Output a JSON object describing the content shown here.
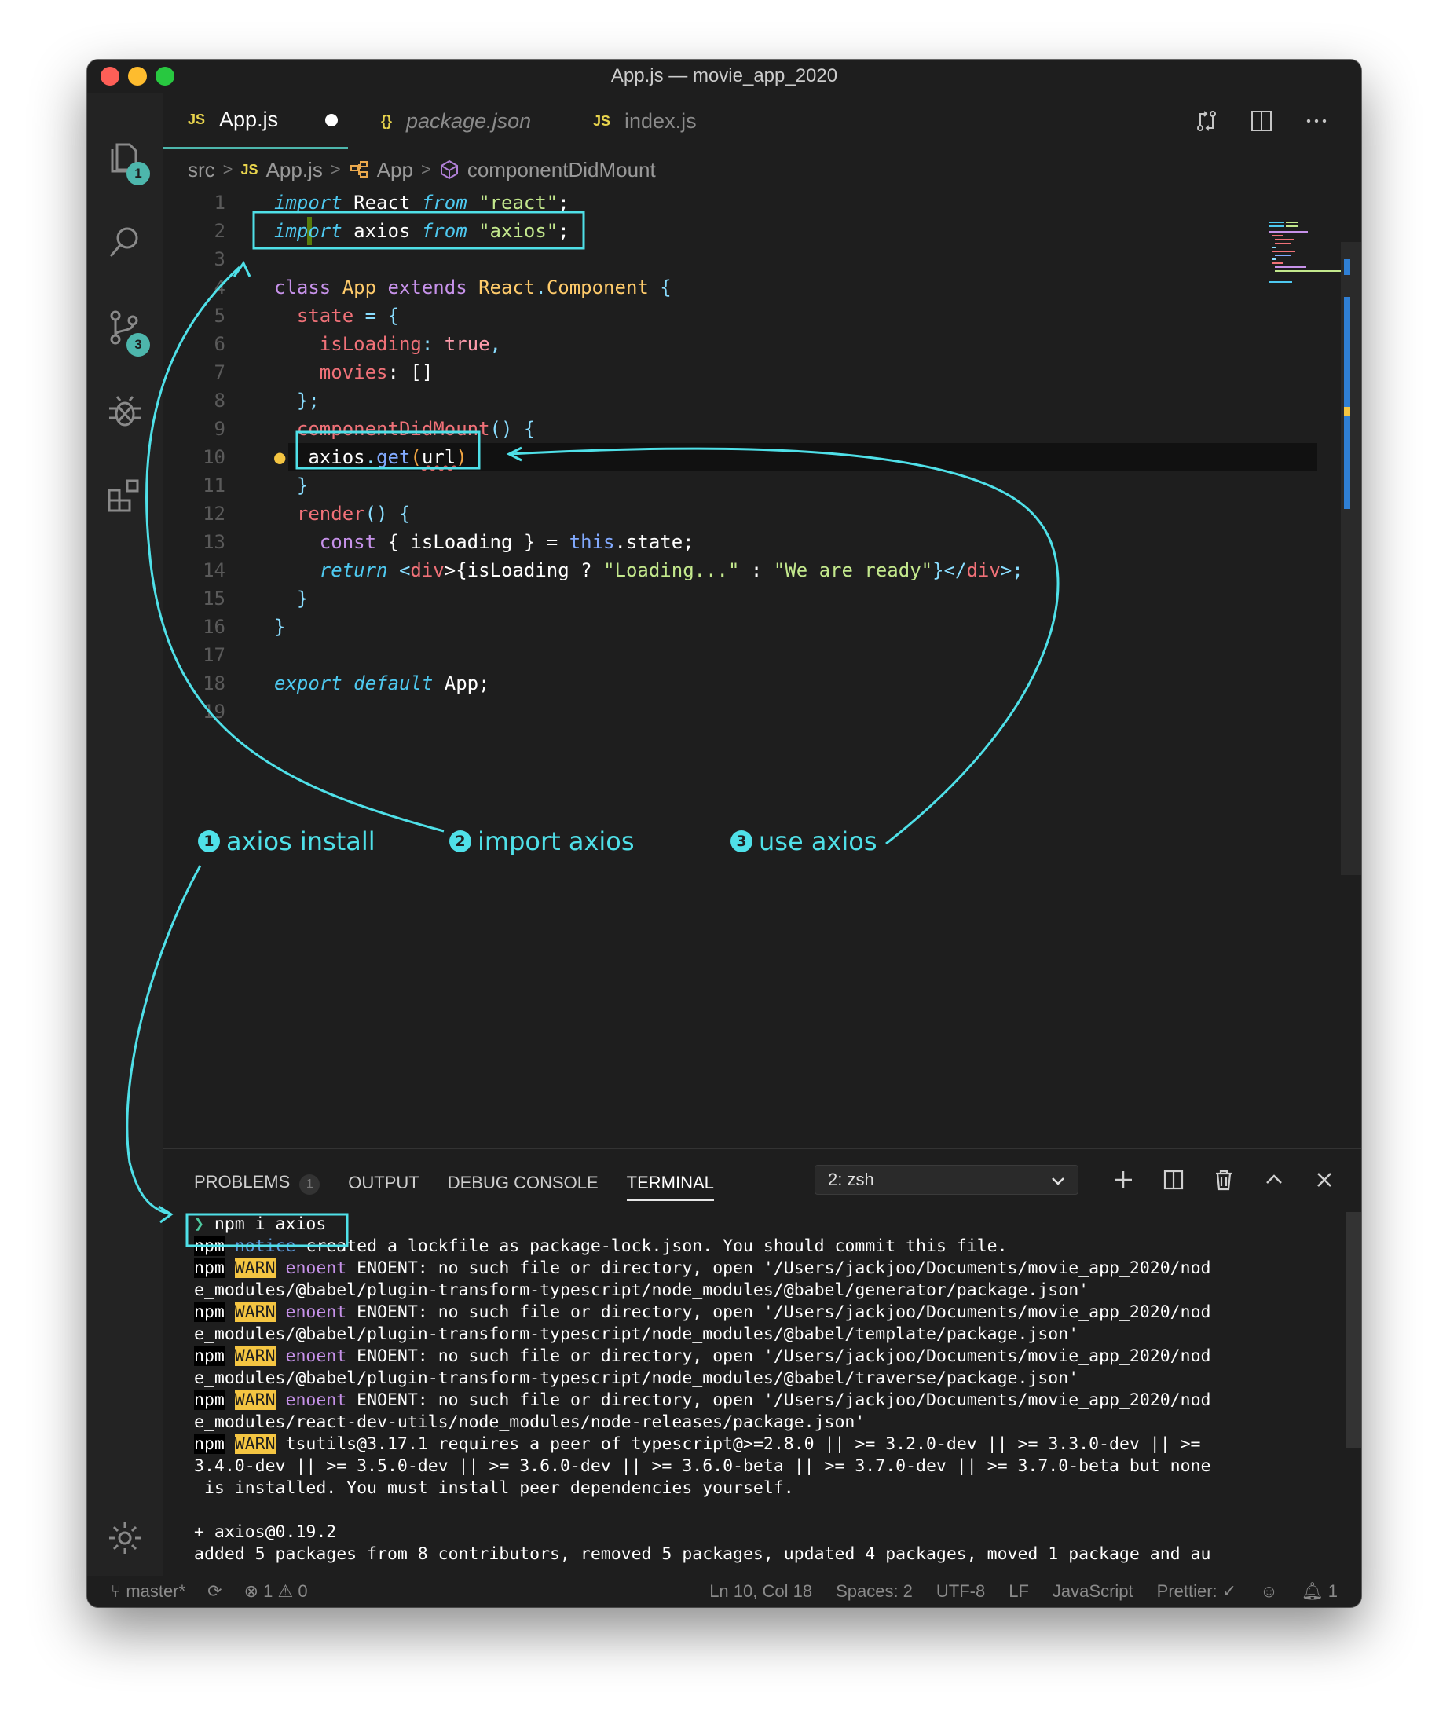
{
  "window": {
    "title": "App.js — movie_app_2020"
  },
  "colors": {
    "accent": "#4db6ac",
    "annotation": "#4fe0e8",
    "warn": "#f4c542",
    "editor_bg": "#1e1e1e"
  },
  "activity": {
    "explorer_badge": "1",
    "scm_badge": "3",
    "icons": [
      "files-icon",
      "search-icon",
      "source-control-icon",
      "debug-icon",
      "extensions-icon",
      "gear-icon"
    ]
  },
  "tabs": [
    {
      "icon": "JS",
      "label": "App.js",
      "modified": true
    },
    {
      "icon": "{}",
      "label": "package.json"
    },
    {
      "icon": "JS",
      "label": "index.js"
    }
  ],
  "breadcrumb": {
    "folder": "src",
    "file_icon": "JS",
    "file": "App.js",
    "class": "App",
    "method": "componentDidMount"
  },
  "code_lines": [
    "1",
    "2",
    "3",
    "4",
    "5",
    "6",
    "7",
    "8",
    "9",
    "10",
    "11",
    "12",
    "13",
    "14",
    "15",
    "16",
    "17",
    "18",
    "19"
  ],
  "code": {
    "l1": {
      "a": "import",
      "b": " React ",
      "c": "from",
      "d": " \"react\"",
      "e": ";"
    },
    "l2": {
      "a": "import",
      "b": " axios ",
      "c": "from",
      "d": " \"axios\"",
      "e": ";"
    },
    "l4": {
      "a": "class",
      "b": " App ",
      "c": "extends",
      "d": " React",
      "e": ".",
      "f": "Component",
      "g": " {"
    },
    "l5": {
      "a": "  state",
      "b": " = {"
    },
    "l6": {
      "a": "    isLoading",
      "b": ": ",
      "c": "true",
      "d": ","
    },
    "l7": {
      "a": "    movies",
      "b": ": []"
    },
    "l8": {
      "a": "  };"
    },
    "l9": {
      "a": "  componentDidMount",
      "b": "() {"
    },
    "l10": {
      "a": "axios",
      "b": ".",
      "c": "get",
      "d": "(",
      "e": "url",
      "f": ")"
    },
    "l11": {
      "a": "  }"
    },
    "l12": {
      "a": "  render",
      "b": "() {"
    },
    "l13": {
      "a": "    const",
      "b": " { isLoading } = ",
      "c": "this",
      "d": ".state;"
    },
    "l14": {
      "a": "    return",
      "b": " <",
      "c": "div",
      "d": ">{isLoading ? ",
      "e": "\"Loading...\"",
      "f": " : ",
      "g": "\"We are ready\"",
      "h": "}</",
      "i": "div",
      "j": ">;"
    },
    "l15": {
      "a": "  }"
    },
    "l16": {
      "a": "}"
    },
    "l18": {
      "a": "export",
      "b": " ",
      "c": "default",
      "d": " App;"
    }
  },
  "annotations": {
    "step1": {
      "num": "1",
      "label": "axios  install"
    },
    "step2": {
      "num": "2",
      "label": "import axios"
    },
    "step3": {
      "num": "3",
      "label": "use axios"
    }
  },
  "panel": {
    "tabs": [
      "PROBLEMS",
      "OUTPUT",
      "DEBUG CONSOLE",
      "TERMINAL"
    ],
    "problems_count": "1",
    "active_tab": "TERMINAL",
    "terminal_select": "2: zsh"
  },
  "terminal": {
    "prompt": "❯",
    "command": " npm i axios",
    "npm": "npm",
    "notice": "notice",
    "warn": "WARN",
    "enoent": "enoent",
    "notice_text": " created a lockfile as package-lock.json. You should commit this file.",
    "warn1a": " ENOENT: no such file or directory, open '/Users/jackjoo/Documents/movie_app_2020/nod",
    "warn1b": "e_modules/@babel/plugin-transform-typescript/node_modules/@babel/generator/package.json'",
    "warn2a": " ENOENT: no such file or directory, open '/Users/jackjoo/Documents/movie_app_2020/nod",
    "warn2b": "e_modules/@babel/plugin-transform-typescript/node_modules/@babel/template/package.json'",
    "warn3a": " ENOENT: no such file or directory, open '/Users/jackjoo/Documents/movie_app_2020/nod",
    "warn3b": "e_modules/@babel/plugin-transform-typescript/node_modules/@babel/traverse/package.json'",
    "warn4a": " ENOENT: no such file or directory, open '/Users/jackjoo/Documents/movie_app_2020/nod",
    "warn4b": "e_modules/react-dev-utils/node_modules/node-releases/package.json'",
    "warn5a": " tsutils@3.17.1 requires a peer of typescript@>=2.8.0 || >= 3.2.0-dev || >= 3.3.0-dev || >=",
    "warn5b": "3.4.0-dev || >= 3.5.0-dev || >= 3.6.0-dev || >= 3.6.0-beta || >= 3.7.0-dev || >= 3.7.0-beta but none",
    "warn5c": " is installed. You must install peer dependencies yourself.",
    "added_pkg": "+ axios@0.19.2",
    "summary": "added 5 packages from 8 contributors, removed 5 packages, updated 4 packages, moved 1 package and au"
  },
  "status": {
    "branch": "master*",
    "errors": "1",
    "warnings": "0",
    "position": "Ln 10, Col 18",
    "spaces": "Spaces: 2",
    "encoding": "UTF-8",
    "eol": "LF",
    "language": "JavaScript",
    "prettier": "Prettier: ✓",
    "notifications": "1"
  }
}
